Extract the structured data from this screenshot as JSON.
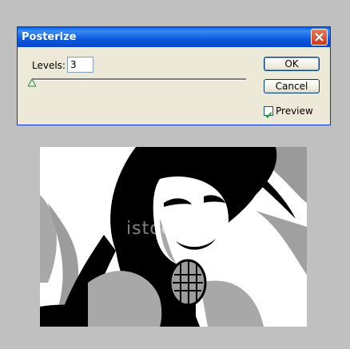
{
  "dialog": {
    "title": "Posterize",
    "levels_label": "Levels:",
    "levels_value": "3",
    "ok_label": "OK",
    "cancel_label": "Cancel",
    "preview_label": "Preview",
    "preview_checked": true,
    "slider_level": 0
  },
  "image": {
    "watermark": "istockphoto"
  },
  "colors": {
    "accent": "#0a5fe4",
    "dialog_bg": "#ece9d8",
    "canvas_bg": "#c0c0c0"
  }
}
